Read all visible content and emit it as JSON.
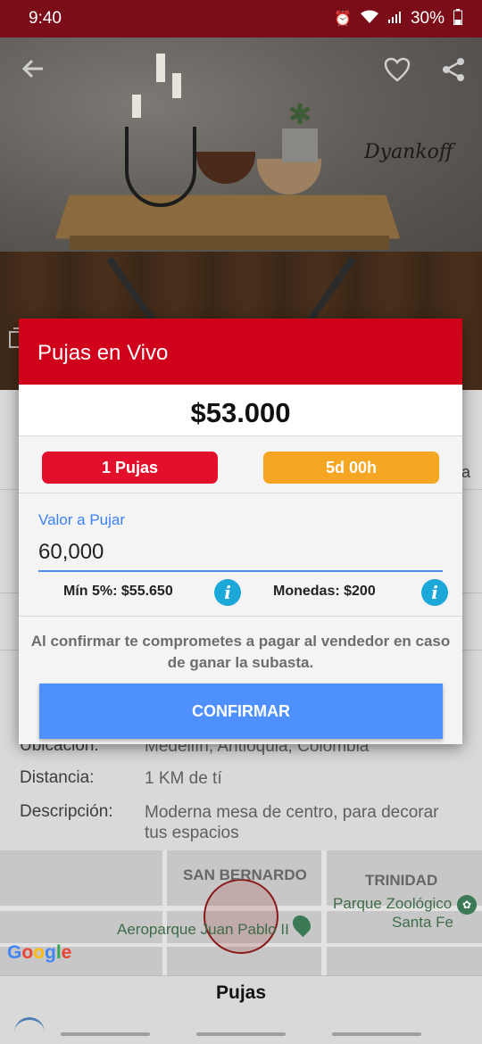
{
  "status_bar": {
    "time": "9:40",
    "battery": "30%",
    "icons": [
      "alarm-icon",
      "wifi-icon",
      "signal-icon",
      "battery-icon"
    ]
  },
  "hero": {
    "watermark": "Dyankoff",
    "icons": [
      "back-arrow-icon",
      "heart-icon",
      "share-icon",
      "gallery-icon"
    ]
  },
  "details": {
    "partial_right": "a",
    "rows": [
      {
        "label": "Ubicación:",
        "value": "Medellín, Antioquia, Colombia"
      },
      {
        "label": "Distancia:",
        "value": "1 KM de tí"
      },
      {
        "label": "Descripción:",
        "value": "Moderna mesa de centro, para decorar tus espacios"
      }
    ]
  },
  "map": {
    "labels": {
      "san_bernardo": "SAN BERNARDO",
      "trinidad": "TRINIDAD",
      "zoo_line1": "Parque Zoológico",
      "zoo_line2": "Santa Fe",
      "aeroparque": "Aeroparque Juan Pablo II"
    },
    "logo": "Google"
  },
  "pujas_section": {
    "title": "Pujas"
  },
  "modal": {
    "title": "Pujas en Vivo",
    "current_price": "$53.000",
    "bids_badge": "1 Pujas",
    "time_badge": "5d 00h",
    "input_label": "Valor a Pujar",
    "input_value": "60,000",
    "min_text": "Mín 5%: $55.650",
    "coins_text": "Monedas: $200",
    "info_glyph": "i",
    "disclaimer": "Al confirmar te comprometes a pagar al vendedor en caso de ganar la subasta.",
    "confirm_label": "CONFIRMAR"
  },
  "colors": {
    "header_red": "#d0021b",
    "badge_red": "#e3102b",
    "badge_orange": "#f5a623",
    "confirm_blue": "#4d90fe",
    "info_blue": "#1ba7d8"
  }
}
